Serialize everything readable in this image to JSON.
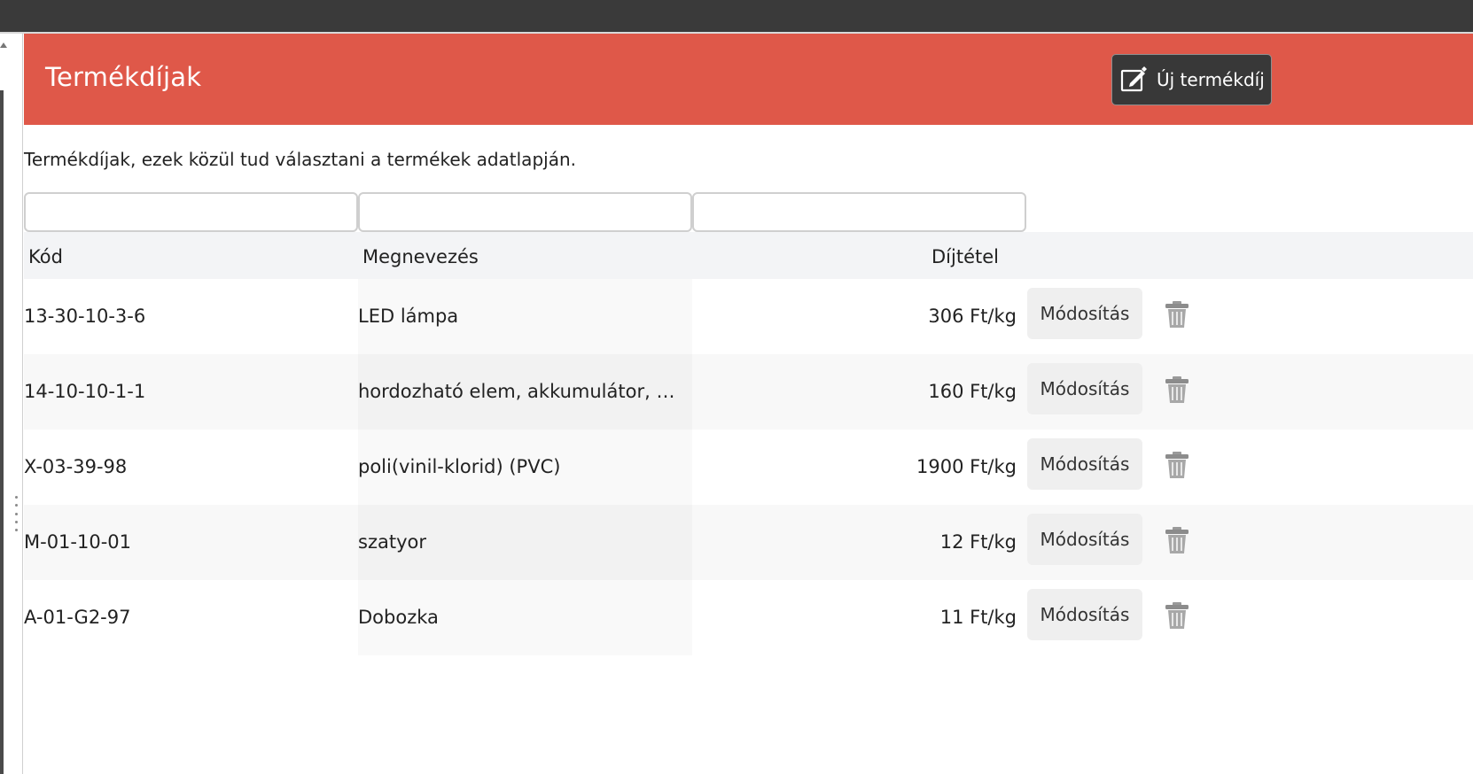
{
  "header": {
    "title": "Termékdíjak",
    "new_button_label": "Új termékdíj",
    "new_button_icon": "edit-icon"
  },
  "description": "Termékdíjak, ezek közül tud választani a termékek adatlapján.",
  "filters": {
    "code": "",
    "name": "",
    "rate": ""
  },
  "table": {
    "columns": {
      "code": "Kód",
      "name": "Megnevezés",
      "rate": "Díjtétel"
    },
    "rows": [
      {
        "code": "13-30-10-3-6",
        "name": "LED lámpa",
        "rate": "306 Ft/kg",
        "edit_label": "Módosítás",
        "delete_icon": "trash-icon"
      },
      {
        "code": "14-10-10-1-1",
        "name": "hordozható elem, akkumulátor, a kö...",
        "rate": "160 Ft/kg",
        "edit_label": "Módosítás",
        "delete_icon": "trash-icon"
      },
      {
        "code": "X-03-39-98",
        "name": "poli(vinil-klorid) (PVC)",
        "rate": "1900 Ft/kg",
        "edit_label": "Módosítás",
        "delete_icon": "trash-icon"
      },
      {
        "code": "M-01-10-01",
        "name": "szatyor",
        "rate": "12 Ft/kg",
        "edit_label": "Módosítás",
        "delete_icon": "trash-icon"
      },
      {
        "code": "A-01-G2-97",
        "name": "Dobozka",
        "rate": "11 Ft/kg",
        "edit_label": "Módosítás",
        "delete_icon": "trash-icon"
      }
    ]
  },
  "colors": {
    "header_bg": "#df5849",
    "top_bar": "#3a3a3a",
    "button_dark": "#383838"
  }
}
